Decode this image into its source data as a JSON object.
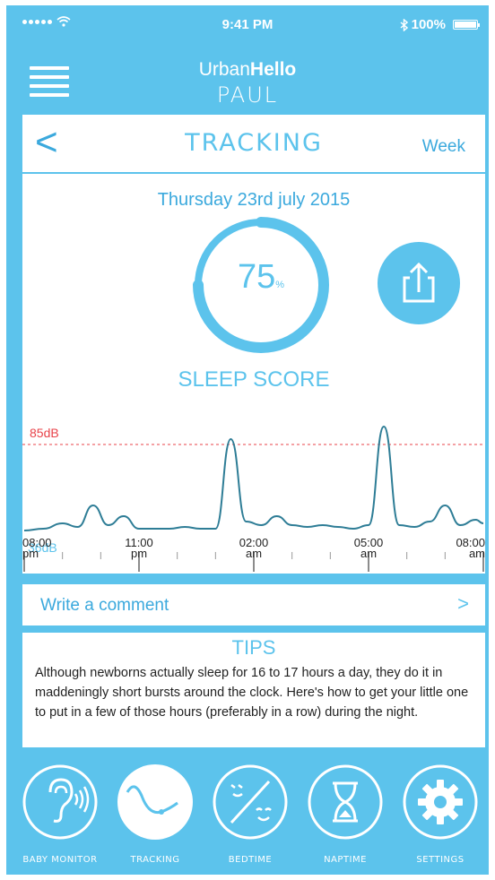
{
  "status_bar": {
    "time": "9:41 PM",
    "battery": "100%"
  },
  "app": {
    "brand_light": "Urban",
    "brand_bold": "Hello",
    "baby_name": "PAUL"
  },
  "tracking": {
    "title": "TRACKING",
    "range": "Week",
    "date": "Thursday 23rd july 2015",
    "score": "75",
    "score_unit": "%",
    "score_fraction": 0.75,
    "score_label": "SLEEP SCORE"
  },
  "chart_data": {
    "type": "line",
    "threshold_label": "85dB",
    "baseline_label": "36dB",
    "threshold_db": 85,
    "baseline_db": 36,
    "x_labels": [
      {
        "time": "08:00",
        "ampm": "pm"
      },
      {
        "time": "11:00",
        "ampm": "pm"
      },
      {
        "time": "02:00",
        "ampm": "am"
      },
      {
        "time": "05:00",
        "ampm": "am"
      },
      {
        "time": "08:00",
        "ampm": "am"
      }
    ],
    "x_hours": [
      0,
      0.5,
      1,
      1.4,
      1.8,
      2.2,
      2.6,
      3,
      3.4,
      3.8,
      4.2,
      4.6,
      5,
      5.4,
      5.8,
      6.2,
      6.6,
      7,
      7.4,
      7.8,
      8.2,
      8.6,
      9,
      9.4,
      9.8,
      10.2,
      10.6,
      11,
      11.4,
      11.8,
      12
    ],
    "values": [
      37,
      38,
      41,
      39,
      51,
      40,
      45,
      38,
      38,
      38,
      39,
      38,
      38,
      88,
      42,
      40,
      45,
      40,
      39,
      40,
      39,
      38,
      40,
      95,
      40,
      39,
      42,
      51,
      40,
      43,
      41
    ]
  },
  "comment": {
    "label": "Write a comment",
    "chevron": ">"
  },
  "tips": {
    "title": "TIPS",
    "body": "Although newborns actually sleep for 16 to 17 hours a day, they do it in maddeningly short bursts around the clock. Here's how to get your little one to put in a few of those hours (preferably in a row) during the night."
  },
  "tabs": [
    {
      "label": "BABY MONITOR",
      "icon": "ear-icon",
      "active": false
    },
    {
      "label": "TRACKING",
      "icon": "sleep-wave-icon",
      "active": true
    },
    {
      "label": "BEDTIME",
      "icon": "faces-icon",
      "active": false
    },
    {
      "label": "NAPTIME",
      "icon": "hourglass-icon",
      "active": false
    },
    {
      "label": "SETTINGS",
      "icon": "gear-icon",
      "active": false
    }
  ],
  "colors": {
    "primary": "#5cc3ec",
    "accent": "#3ba9dd",
    "threshold": "#e8434a",
    "line": "#2e7d96"
  }
}
